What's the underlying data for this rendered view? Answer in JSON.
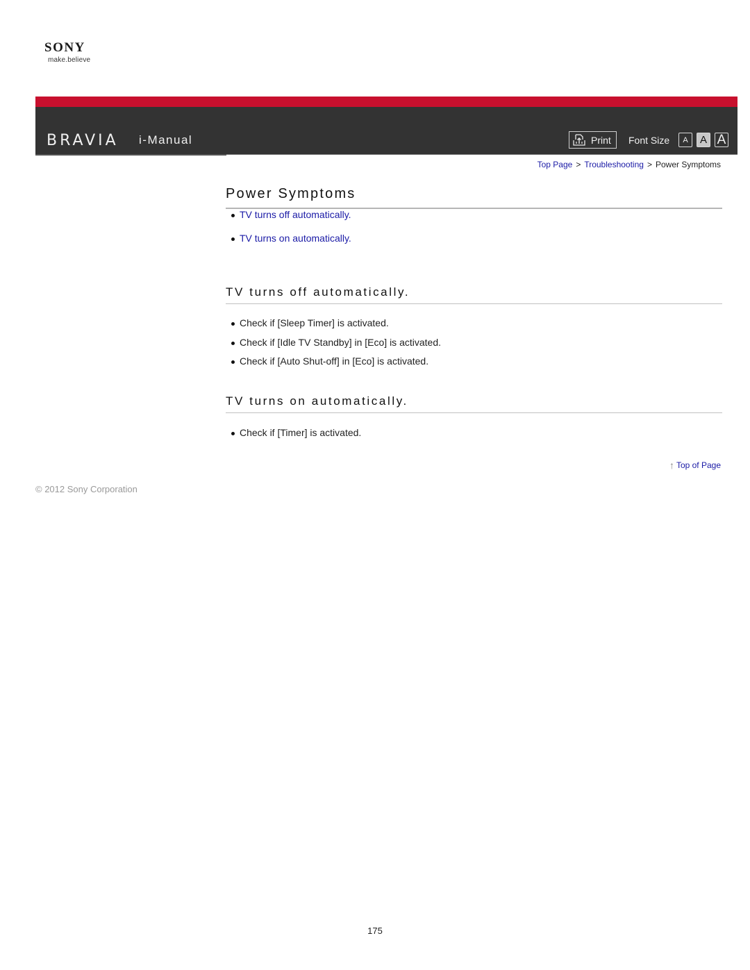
{
  "brand": {
    "logo": "SONY",
    "tagline": "make.believe"
  },
  "header": {
    "product": "BRAVIA",
    "app_title": "i-Manual",
    "print_label": "Print",
    "print_icon": "print-icon",
    "font_size_label": "Font Size",
    "font_size_options": [
      "A",
      "A",
      "A"
    ],
    "font_size_selected": "medium",
    "accent_color": "#c8102e",
    "bar_color": "#333333"
  },
  "breadcrumb": {
    "items": [
      {
        "label": "Top Page",
        "link": true
      },
      {
        "label": "Troubleshooting",
        "link": true
      },
      {
        "label": "Power Symptoms",
        "link": false
      }
    ],
    "separator": ">"
  },
  "page": {
    "title": "Power Symptoms",
    "toc": [
      "TV turns off automatically.",
      "TV turns on automatically."
    ],
    "sections": [
      {
        "heading": "TV turns off automatically.",
        "items": [
          "Check if [Sleep Timer] is activated.",
          "Check if [Idle TV Standby] in [Eco] is activated.",
          "Check if [Auto Shut-off] in [Eco] is activated."
        ]
      },
      {
        "heading": "TV turns on automatically.",
        "items": [
          "Check if [Timer] is activated."
        ]
      }
    ],
    "top_of_page": "Top of Page"
  },
  "footer": {
    "copyright": "© 2012 Sony Corporation",
    "page_number": "175"
  }
}
